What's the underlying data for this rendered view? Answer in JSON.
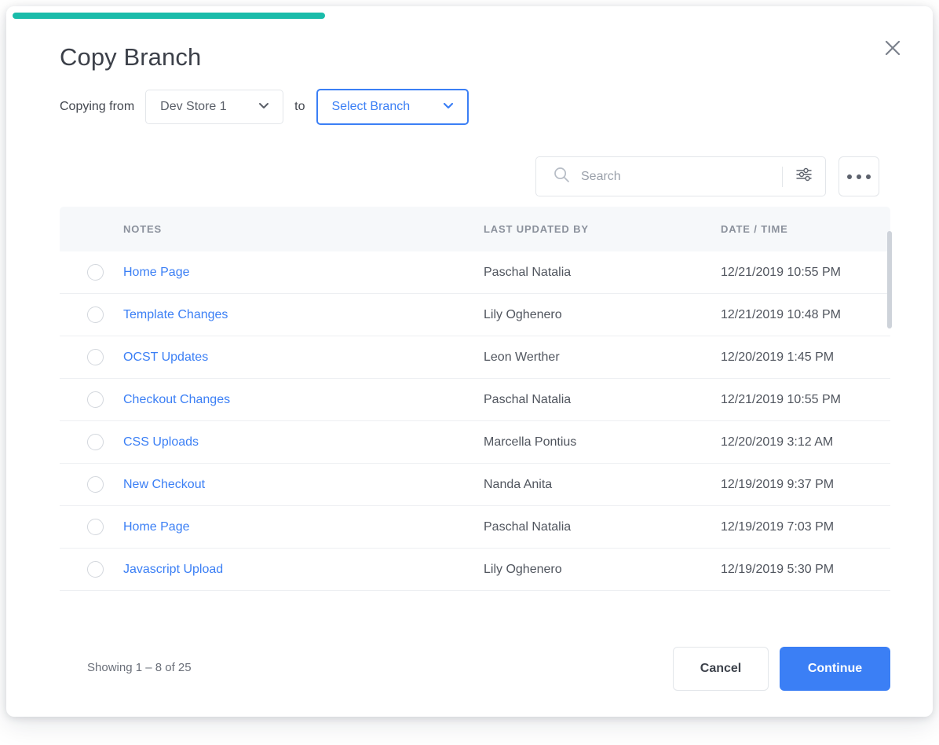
{
  "modal": {
    "title": "Copy Branch",
    "progress_percent": 34,
    "progress_color": "#1abcaa",
    "accent_color": "#3b7ff5",
    "close_icon": "close-icon"
  },
  "copy_from": {
    "lead_label": "Copying from",
    "source_value": "Dev Store 1",
    "connector_label": "to",
    "target_value": "Select Branch",
    "chevron_icon": "chevron-down-icon"
  },
  "toolbar": {
    "search_placeholder": "Search",
    "search_value": "",
    "search_icon": "search-icon",
    "filter_icon": "sliders-icon",
    "more_icon": "ellipsis-icon"
  },
  "table": {
    "columns": [
      "NOTES",
      "LAST UPDATED BY",
      "DATE / TIME"
    ],
    "rows": [
      {
        "note": "Home Page",
        "user": "Paschal Natalia",
        "datetime": "12/21/2019 10:55 PM"
      },
      {
        "note": "Template Changes",
        "user": "Lily Oghenero",
        "datetime": "12/21/2019 10:48 PM"
      },
      {
        "note": "OCST Updates",
        "user": "Leon Werther",
        "datetime": "12/20/2019 1:45 PM"
      },
      {
        "note": "Checkout Changes",
        "user": "Paschal Natalia",
        "datetime": "12/21/2019 10:55 PM"
      },
      {
        "note": "CSS Uploads",
        "user": "Marcella Pontius",
        "datetime": "12/20/2019 3:12 AM"
      },
      {
        "note": "New Checkout",
        "user": "Nanda Anita",
        "datetime": "12/19/2019 9:37 PM"
      },
      {
        "note": "Home Page",
        "user": "Paschal Natalia",
        "datetime": "12/19/2019 7:03 PM"
      },
      {
        "note": "Javascript Upload",
        "user": "Lily Oghenero",
        "datetime": "12/19/2019 5:30 PM"
      }
    ]
  },
  "footer": {
    "showing_text": "Showing 1 – 8 of 25",
    "cancel_label": "Cancel",
    "continue_label": "Continue"
  }
}
